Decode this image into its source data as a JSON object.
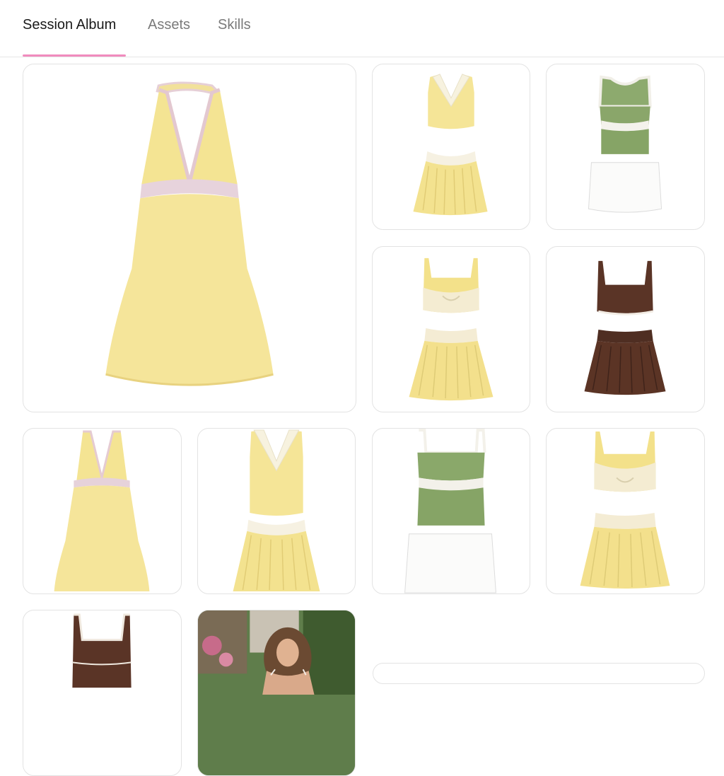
{
  "tabs": [
    {
      "label": "Session Album",
      "active": true
    },
    {
      "label": "Assets",
      "active": false
    },
    {
      "label": "Skills",
      "active": false
    }
  ],
  "accent_color": "#f08bbd",
  "album": {
    "items": [
      {
        "kind": "image",
        "depicts": "yellow halter tennis dress",
        "featured": true
      },
      {
        "kind": "image",
        "depicts": "yellow collared top and pleated skirt set"
      },
      {
        "kind": "image",
        "depicts": "green knit top and white skirt set"
      },
      {
        "kind": "image",
        "depicts": "yellow twist bralette and pleated skirt set"
      },
      {
        "kind": "image",
        "depicts": "brown bra top and pleated skirt set"
      },
      {
        "kind": "image",
        "depicts": "yellow halter tennis dress"
      },
      {
        "kind": "image",
        "depicts": "yellow collared top and pleated skirt set"
      },
      {
        "kind": "image",
        "depicts": "green knit cami and white skirt set"
      },
      {
        "kind": "image",
        "depicts": "yellow twist bralette and pleated skirt set"
      },
      {
        "kind": "image",
        "depicts": "brown tank top"
      },
      {
        "kind": "image",
        "depicts": "smiling woman outdoors photo"
      }
    ]
  }
}
